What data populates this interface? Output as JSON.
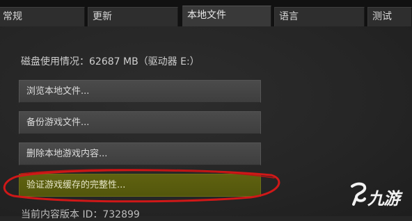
{
  "tabs": [
    {
      "label": "常规"
    },
    {
      "label": "更新"
    },
    {
      "label": "本地文件",
      "active": true
    },
    {
      "label": "语言"
    },
    {
      "label": "测试"
    }
  ],
  "local_files": {
    "disk_usage": "磁盘使用情况：62687 MB（驱动器 E:）",
    "buttons": [
      {
        "label": "浏览本地文件..."
      },
      {
        "label": "备份游戏文件..."
      },
      {
        "label": "删除本地游戏内容..."
      },
      {
        "label": "验证游戏缓存的完整性..."
      }
    ],
    "build_id": "当前内容版本 ID：732899"
  },
  "watermark": {
    "text": "九游"
  },
  "colors": {
    "background": "#262626",
    "button": "#444444",
    "highlighted_button": "#5a5d0f",
    "annotation_circle": "#d01818"
  }
}
